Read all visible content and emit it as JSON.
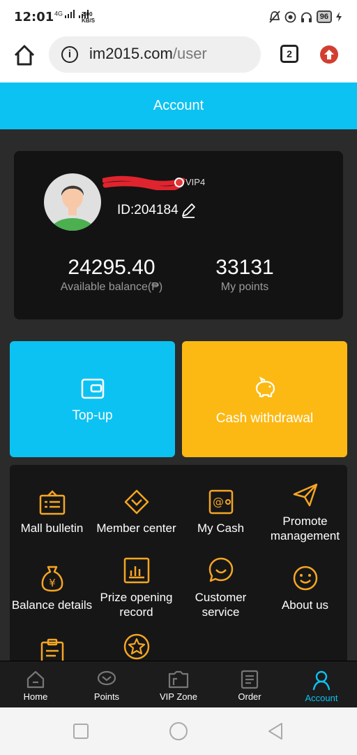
{
  "status_bar": {
    "time": "12:01",
    "network": "4G",
    "speed_value": "2.00",
    "speed_unit": "KB/S",
    "battery": "96"
  },
  "browser": {
    "url_domain": "im2015.com",
    "url_path": "/user",
    "tab_count": "2"
  },
  "header": {
    "title": "Account"
  },
  "profile": {
    "vip_level": "VIP4",
    "id_text": "ID:204184",
    "balance_value": "24295.40",
    "balance_label": "Available balance(₱)",
    "points_value": "33131",
    "points_label": "My points"
  },
  "actions": {
    "topup_label": "Top-up",
    "withdraw_label": "Cash withdrawal",
    "colors": {
      "topup": "#0cc2f2",
      "withdraw": "#fcb913"
    }
  },
  "menu": {
    "items": [
      {
        "label": "Mall bulletin",
        "icon": "bulletin-icon"
      },
      {
        "label": "Member center",
        "icon": "member-center-icon"
      },
      {
        "label": "My Cash",
        "icon": "wallet-icon"
      },
      {
        "label": "Promote management",
        "icon": "paper-plane-icon"
      },
      {
        "label": "Balance details",
        "icon": "money-bag-icon"
      },
      {
        "label": "Prize opening record",
        "icon": "bar-chart-icon"
      },
      {
        "label": "Customer service",
        "icon": "chat-smile-icon"
      },
      {
        "label": "About us",
        "icon": "smiley-icon"
      }
    ]
  },
  "tabbar": {
    "items": [
      {
        "label": "Home",
        "icon": "home-icon"
      },
      {
        "label": "Points",
        "icon": "points-icon"
      },
      {
        "label": "VIP Zone",
        "icon": "vip-zone-icon"
      },
      {
        "label": "Order",
        "icon": "order-icon"
      },
      {
        "label": "Account",
        "icon": "account-icon"
      }
    ],
    "active": "Account",
    "active_color": "#0cc2f2"
  }
}
